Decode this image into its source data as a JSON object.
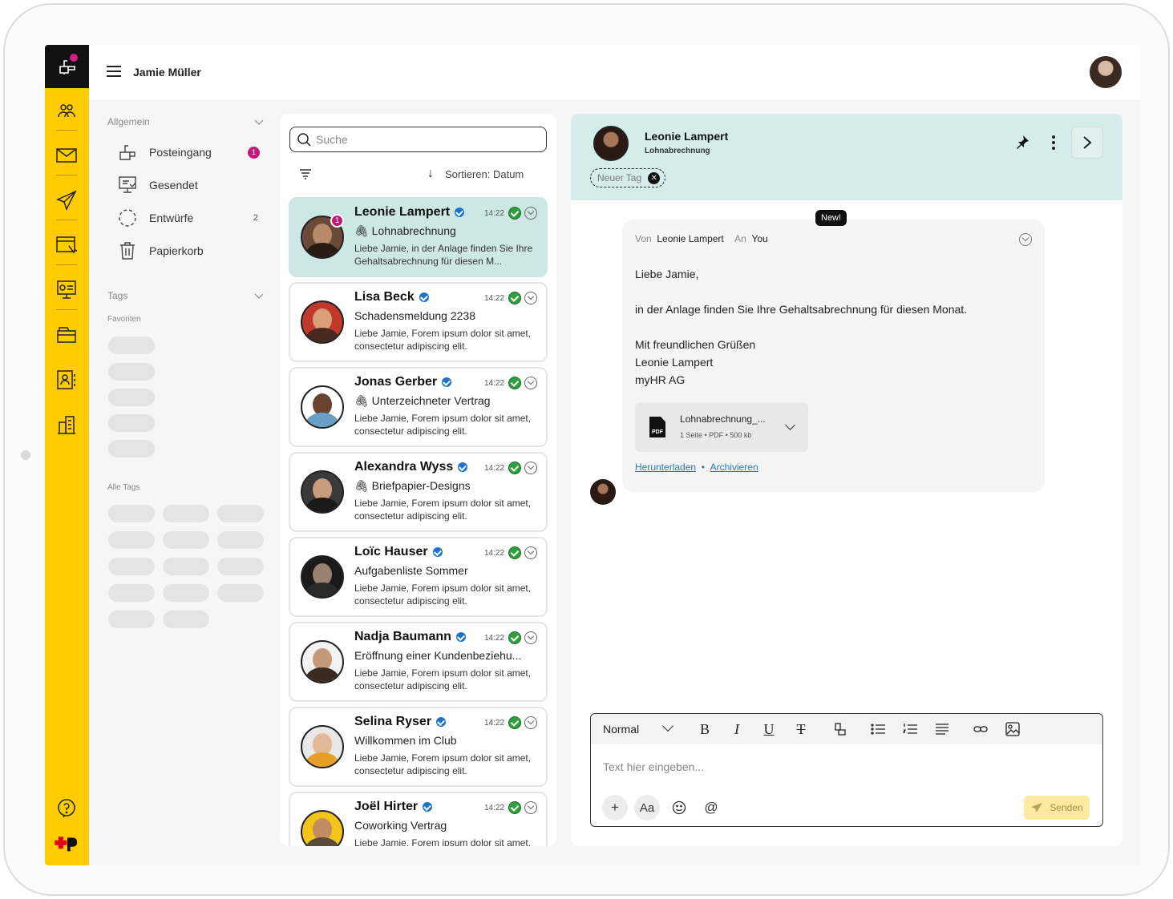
{
  "user": {
    "name": "Jamie Müller"
  },
  "sidebar": {
    "general_label": "Allgemein",
    "items": [
      {
        "label": "Posteingang",
        "badge": "1"
      },
      {
        "label": "Gesendet"
      },
      {
        "label": "Entwürfe",
        "count": "2"
      },
      {
        "label": "Papierkorb"
      }
    ],
    "tags_label": "Tags",
    "favorites_label": "Favoriten",
    "all_tags_label": "Alle Tags"
  },
  "list": {
    "search_placeholder": "Suche",
    "sort_label": "Sortieren: Datum",
    "messages": [
      {
        "name": "Leonie Lampert",
        "time": "14:22",
        "subject": "Lohnabrechnung",
        "attachment": true,
        "preview": "Liebe Jamie, in der Anlage finden Sie Ihre Gehaltsabrechnung für diesen M...",
        "badge": "1"
      },
      {
        "name": "Lisa Beck",
        "time": "14:22",
        "subject": "Schadensmeldung 2238",
        "preview": "Liebe Jamie, Forem ipsum dolor sit amet, consectetur adipiscing elit."
      },
      {
        "name": "Jonas Gerber",
        "time": "14:22",
        "subject": "Unterzeichneter Vertrag",
        "attachment": true,
        "preview": "Liebe Jamie, Forem ipsum dolor sit amet, consectetur adipiscing elit."
      },
      {
        "name": "Alexandra Wyss",
        "time": "14:22",
        "subject": "Briefpapier-Designs",
        "attachment": true,
        "preview": "Liebe Jamie, Forem ipsum dolor sit amet, consectetur adipiscing elit."
      },
      {
        "name": "Loïc Hauser",
        "time": "14:22",
        "subject": "Aufgabenliste Sommer",
        "preview": "Liebe Jamie, Forem ipsum dolor sit amet, consectetur adipiscing elit."
      },
      {
        "name": "Nadja Baumann",
        "time": "14:22",
        "subject": "Eröffnung einer Kundenbeziehu...",
        "preview": "Liebe Jamie, Forem ipsum dolor sit amet, consectetur adipiscing elit."
      },
      {
        "name": "Selina Ryser",
        "time": "14:22",
        "subject": "Willkommen im Club",
        "preview": "Liebe Jamie, Forem ipsum dolor sit amet, consectetur adipiscing elit."
      },
      {
        "name": "Joël Hirter",
        "time": "14:22",
        "subject": "Coworking Vertrag",
        "preview": "Liebe Jamie, Forem ipsum dolor sit amet, consectetur adipiscing elit."
      }
    ]
  },
  "detail": {
    "name": "Leonie Lampert",
    "subject": "Lohnabrechnung",
    "tag_placeholder": "Neuer Tag",
    "new_badge": "New!",
    "from_label": "Von",
    "from_value": "Leonie Lampert",
    "to_label": "An",
    "to_value": "You",
    "body": [
      "Liebe Jamie,",
      "in der Anlage finden Sie Ihre Gehaltsabrechnung für diesen Monat.",
      "Mit freundlichen Grüßen",
      "Leonie Lampert",
      "myHR AG"
    ],
    "attachment": {
      "name": "Lohnabrechnung_...",
      "meta": "1 Seite • PDF • 500 kb",
      "type_label": "PDF"
    },
    "download_label": "Herunterladen",
    "archive_label": "Archivieren",
    "link_separator": "•"
  },
  "editor": {
    "format": "Normal",
    "placeholder": "Text hier eingeben...",
    "send_label": "Senden",
    "text_style_label": "Aa"
  },
  "colors": {
    "rail": "#ffcc00",
    "accent_pink": "#c21a7a",
    "active_card": "#cde7e7",
    "link": "#1f7ab8"
  }
}
